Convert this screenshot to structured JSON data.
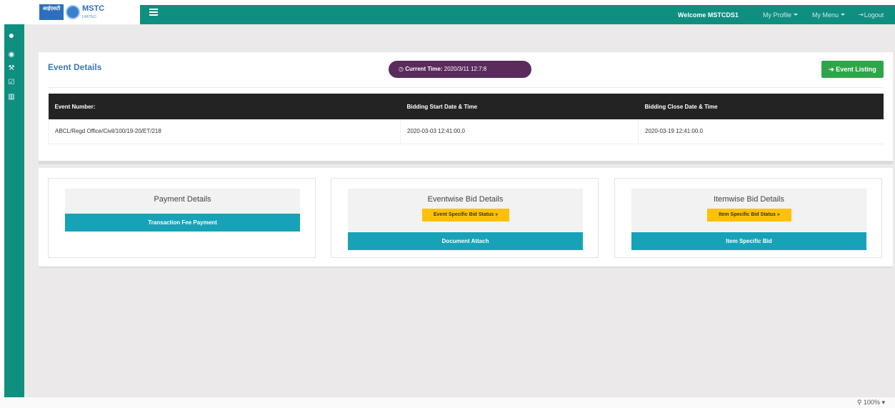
{
  "header": {
    "welcome": "Welcome MSTCDS1",
    "my_profile": "My Profile",
    "my_menu": "My Menu",
    "logout": "Logout",
    "logo_left": "आईएसटी",
    "logo_right": "MSTC",
    "logo_right_sub": "LIMITED",
    "accent_color": "#0e8f80"
  },
  "sidebar": {
    "icons": [
      "user-icon",
      "dashboard-icon",
      "gavel-icon",
      "checklist-icon",
      "chart-icon"
    ]
  },
  "event": {
    "title": "Event Details",
    "time_label": "Current Time:",
    "time_value": "2020/3/11 12:7:8",
    "listing_button": "Event Listing",
    "columns": [
      "Event Number:",
      "Bidding Start Date & Time",
      "Bidding Close Date & Time"
    ],
    "rows": [
      [
        "ABCL/Regd Office/Civil/100/19-20/ET/218",
        "2020-03-03 12:41:00.0",
        "2020-03-19 12:41:00.0"
      ]
    ]
  },
  "panels": {
    "payment": {
      "title": "Payment Details",
      "button": "Transaction Fee Payment"
    },
    "eventwise": {
      "title": "Eventwise Bid Details",
      "status_button": "Event Specific Bid Status »",
      "button": "Document Attach"
    },
    "itemwise": {
      "title": "Itemwise Bid Details",
      "status_button": "Item Specific Bid Status »",
      "button": "Item Specific Bid"
    }
  },
  "statusbar": {
    "zoom": "100%"
  }
}
